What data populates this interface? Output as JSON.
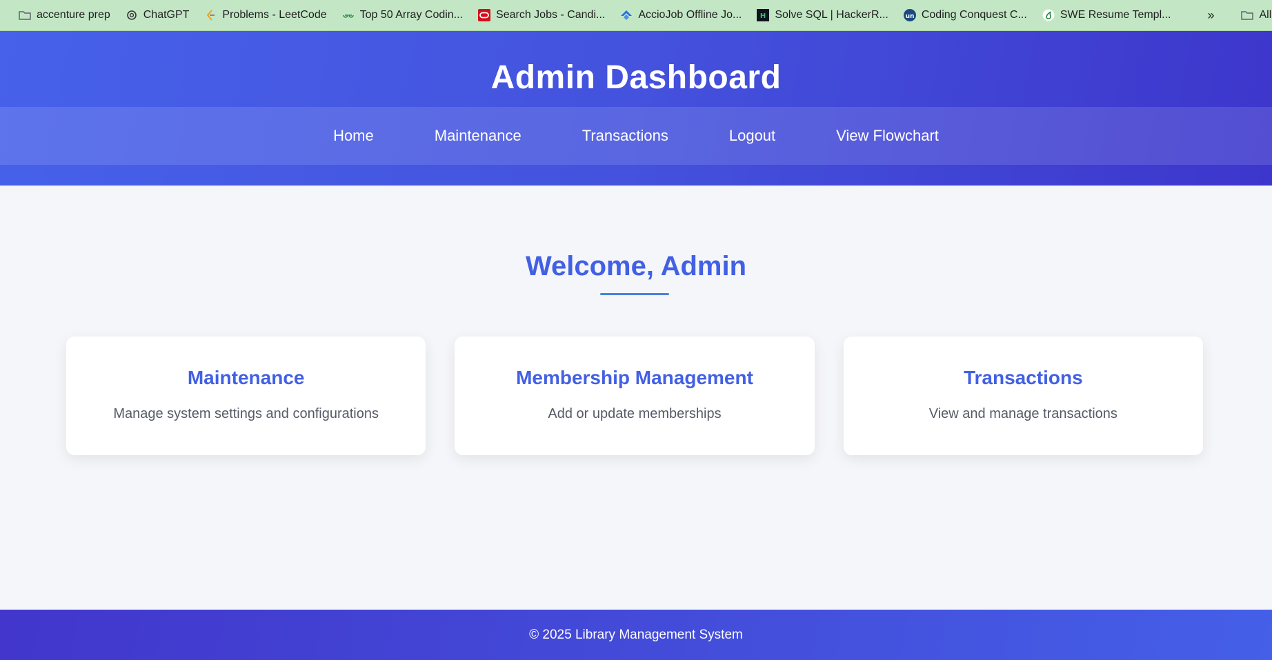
{
  "bookmarks": {
    "items": [
      {
        "label": "accenture prep",
        "icon": "folder-icon"
      },
      {
        "label": "ChatGPT",
        "icon": "chatgpt-icon"
      },
      {
        "label": "Problems - LeetCode",
        "icon": "leetcode-icon"
      },
      {
        "label": "Top 50 Array Codin...",
        "icon": "gfg-icon"
      },
      {
        "label": "Search Jobs - Candi...",
        "icon": "oracle-icon"
      },
      {
        "label": "AccioJob Offline Jo...",
        "icon": "acciojob-icon"
      },
      {
        "label": "Solve SQL | HackerR...",
        "icon": "hackerrank-icon"
      },
      {
        "label": "Coding Conquest C...",
        "icon": "unstop-icon"
      },
      {
        "label": "SWE Resume Templ...",
        "icon": "overleaf-icon"
      }
    ],
    "more": "»",
    "all_bookmarks": "All Bookma"
  },
  "header": {
    "title": "Admin Dashboard",
    "nav": [
      "Home",
      "Maintenance",
      "Transactions",
      "Logout",
      "View Flowchart"
    ]
  },
  "main": {
    "welcome": "Welcome, Admin",
    "cards": [
      {
        "title": "Maintenance",
        "desc": "Manage system settings and configurations"
      },
      {
        "title": "Membership Management",
        "desc": "Add or update memberships"
      },
      {
        "title": "Transactions",
        "desc": "View and manage transactions"
      }
    ]
  },
  "footer": {
    "text": "© 2025 Library Management System"
  },
  "colors": {
    "accent": "#4260e4",
    "header_start": "#4761ea",
    "header_end": "#3d36cc",
    "bookmarks_bar": "#c3e6c5"
  }
}
